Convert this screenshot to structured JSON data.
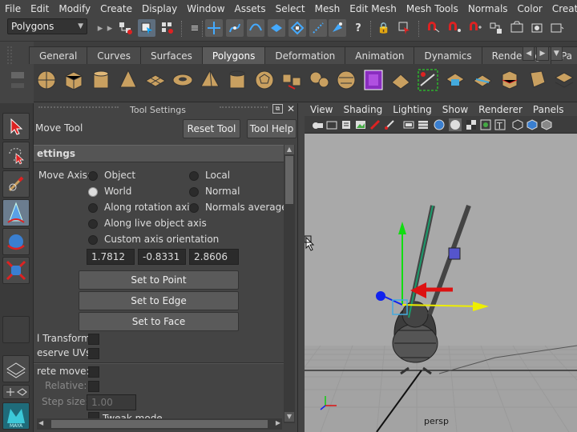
{
  "menubar": {
    "items": [
      "File",
      "Edit",
      "Modify",
      "Create",
      "Display",
      "Window",
      "Assets",
      "Select",
      "Mesh",
      "Edit Mesh",
      "Mesh Tools",
      "Normals",
      "Color",
      "Create UVs"
    ]
  },
  "statusline": {
    "mode": "Polygons",
    "icons": [
      "new-scene-icon",
      "select-hierarchy-icon",
      "select-object-icon",
      "select-component-icon",
      "snap-grid-icon",
      "snap-curve-icon",
      "snap-point-icon",
      "snap-plane-icon",
      "make-live-icon",
      "history-icon",
      "help-icon",
      "lock-icon",
      "select-lock-icon",
      "magnet-icon",
      "symmetry-icon",
      "soft-select-icon",
      "construction-icon",
      "render-icon"
    ]
  },
  "shelf": {
    "tabs": [
      "General",
      "Curves",
      "Surfaces",
      "Polygons",
      "Deformation",
      "Animation",
      "Dynamics",
      "Rendering",
      "Pa"
    ],
    "active_tab": "Polygons",
    "icons": [
      "poly-sphere-icon",
      "poly-cube-icon",
      "poly-cylinder-icon",
      "poly-cone-icon",
      "poly-plane-icon",
      "poly-torus-icon",
      "poly-pyramid-icon",
      "poly-pipe-icon",
      "poly-soccer-icon",
      "combine-icon",
      "separate-icon",
      "smooth-icon",
      "mirror-icon",
      "boolean-icon",
      "extrude-icon",
      "bridge-icon",
      "split-icon",
      "insert-loop-icon",
      "bevel-icon",
      "uv-editor-icon"
    ]
  },
  "tool_settings": {
    "title": "Tool Settings",
    "tool_name": "Move Tool",
    "reset_label": "Reset Tool",
    "help_label": "Tool Help",
    "section": "ettings",
    "move_axis_label": "Move Axis:",
    "axis_options": [
      {
        "label": "Object",
        "selected": false
      },
      {
        "label": "Local",
        "selected": false
      },
      {
        "label": "World",
        "selected": true
      },
      {
        "label": "Normal",
        "selected": false
      },
      {
        "label": "Along rotation axis",
        "selected": false
      },
      {
        "label": "Normals average",
        "selected": false
      },
      {
        "label": "Along live object axis",
        "selected": false
      },
      {
        "label": "Custom axis orientation",
        "selected": false
      }
    ],
    "xyz": [
      "1.7812",
      "-0.8331",
      "2.8606"
    ],
    "set_to_point": "Set to Point",
    "set_to_edge": "Set to Edge",
    "set_to_face": "Set to Face",
    "transform_label": "l Transform",
    "preserve_uvs_label": "eserve UVs",
    "discrete_move_label": "rete move:",
    "relative_label": "Relative:",
    "step_size_label": "Step size:",
    "step_size_value": "1.00",
    "tweak_mode_label": "Tweak mode"
  },
  "viewport": {
    "menu": [
      "View",
      "Shading",
      "Lighting",
      "Show",
      "Renderer",
      "Panels"
    ],
    "camera": "persp"
  },
  "colors": {
    "bg": "#444444",
    "viewport": "#a8a8a8",
    "accent_red": "#dd1111",
    "axis_green": "#22cc22",
    "axis_blue": "#1122ee",
    "axis_yellow": "#eeee00"
  }
}
